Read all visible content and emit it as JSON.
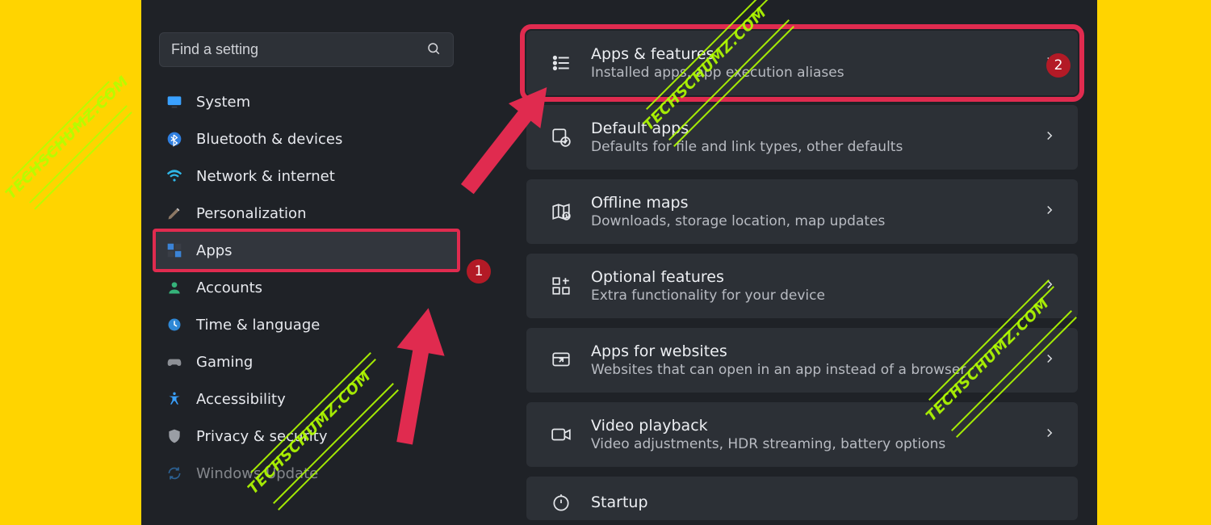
{
  "search": {
    "placeholder": "Find a setting"
  },
  "sidebar": {
    "items": [
      {
        "label": "System"
      },
      {
        "label": "Bluetooth & devices"
      },
      {
        "label": "Network & internet"
      },
      {
        "label": "Personalization"
      },
      {
        "label": "Apps"
      },
      {
        "label": "Accounts"
      },
      {
        "label": "Time & language"
      },
      {
        "label": "Gaming"
      },
      {
        "label": "Accessibility"
      },
      {
        "label": "Privacy & security"
      },
      {
        "label": "Windows Update"
      }
    ]
  },
  "main": {
    "cards": [
      {
        "title": "Apps & features",
        "sub": "Installed apps, app execution aliases"
      },
      {
        "title": "Default apps",
        "sub": "Defaults for file and link types, other defaults"
      },
      {
        "title": "Offline maps",
        "sub": "Downloads, storage location, map updates"
      },
      {
        "title": "Optional features",
        "sub": "Extra functionality for your device"
      },
      {
        "title": "Apps for websites",
        "sub": "Websites that can open in an app instead of a browser"
      },
      {
        "title": "Video playback",
        "sub": "Video adjustments, HDR streaming, battery options"
      },
      {
        "title": "Startup",
        "sub": ""
      }
    ]
  },
  "annotations": {
    "badge1": "1",
    "badge2": "2",
    "watermark": "TECHSCHUMZ.COM"
  }
}
